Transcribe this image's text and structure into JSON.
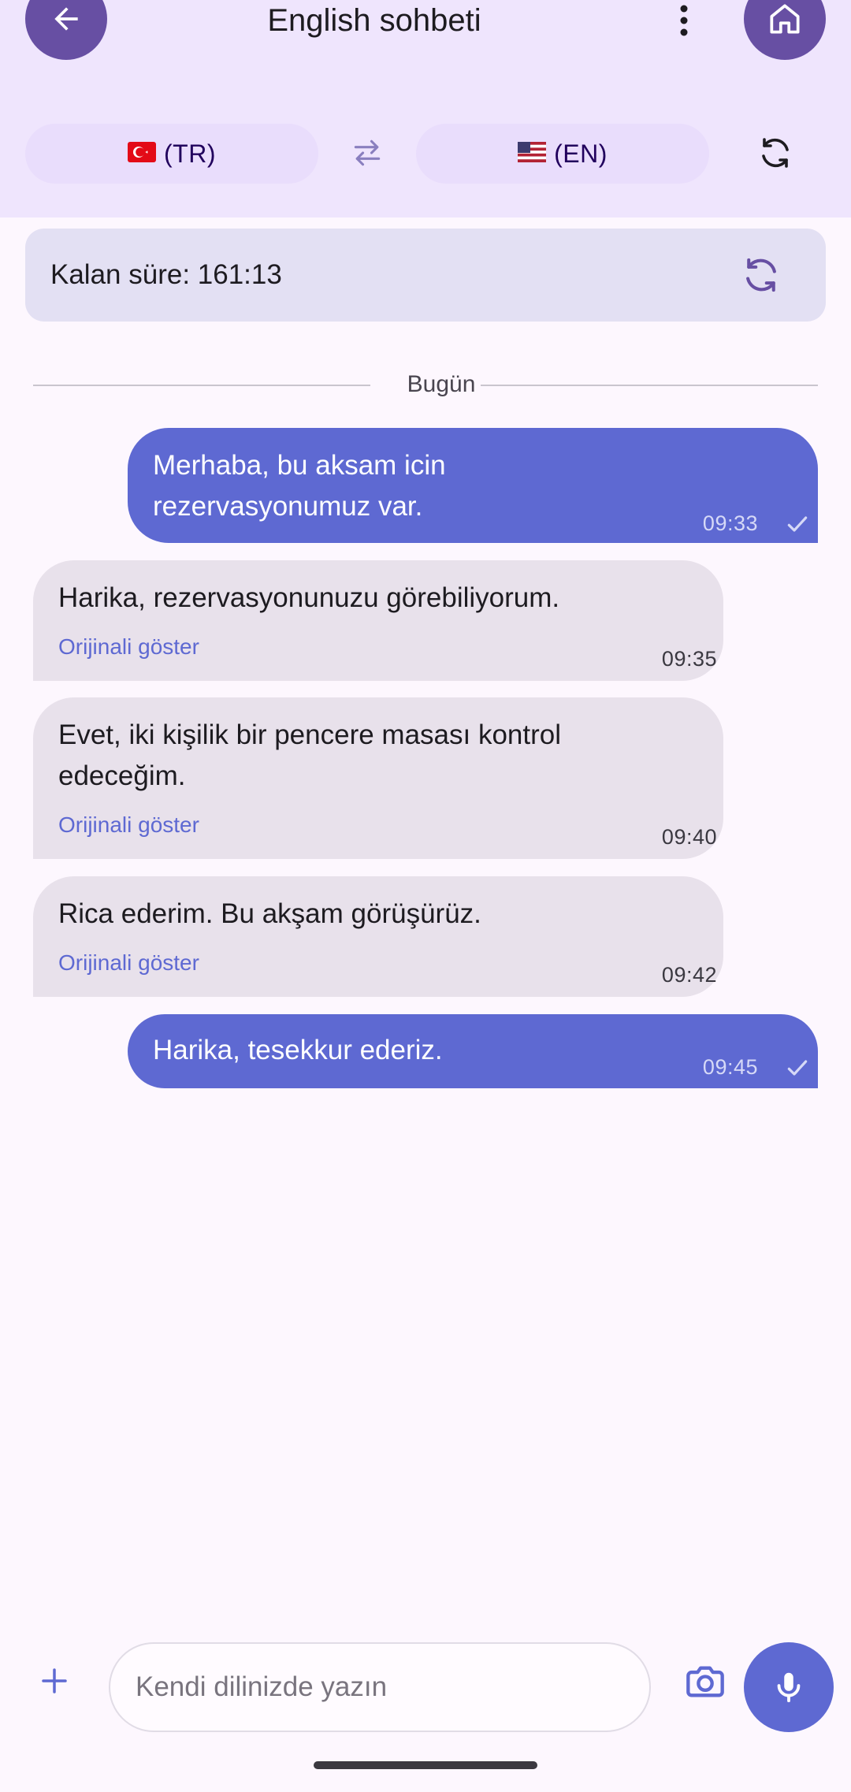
{
  "header": {
    "title": "English sohbeti",
    "back_icon": "arrow-left-icon",
    "home_icon": "home-icon",
    "more_icon": "more-vertical-icon"
  },
  "languages": {
    "source": {
      "flag": "flag-turkey-icon",
      "code": "(TR)"
    },
    "target": {
      "flag": "flag-usa-icon",
      "code": "(EN)"
    },
    "swap_icon": "swap-horizontal-icon",
    "refresh_icon": "refresh-icon"
  },
  "timer": {
    "text": "Kalan süre: 161:13",
    "refresh_icon": "refresh-icon"
  },
  "chat": {
    "date_divider": "Bugün",
    "messages": [
      {
        "direction": "outgoing",
        "text": "Merhaba, bu aksam icin rezervasyonumuz var.",
        "time": "09:33",
        "status_icon": "check-icon"
      },
      {
        "direction": "incoming",
        "text": "Harika, rezervasyonunuzu görebiliyorum.",
        "link": "Orijinali göster",
        "time": "09:35"
      },
      {
        "direction": "incoming",
        "text": "Evet, iki kişilik bir pencere masası kontrol edeceğim.",
        "link": "Orijinali göster",
        "time": "09:40"
      },
      {
        "direction": "incoming",
        "text": "Rica ederim. Bu akşam görüşürüz.",
        "link": "Orijinali göster",
        "time": "09:42"
      },
      {
        "direction": "outgoing",
        "text": "Harika, tesekkur ederiz.",
        "time": "09:45",
        "status_icon": "check-icon"
      }
    ]
  },
  "composer": {
    "placeholder": "Kendi dilinizde yazın",
    "value": "",
    "add_icon": "plus-icon",
    "camera_icon": "camera-icon",
    "mic_icon": "microphone-icon"
  },
  "colors": {
    "accent": "#5E69D2",
    "header_button": "#674FA3",
    "header_bg": "#EFE5FD",
    "incoming_bubble": "#E8E1EB",
    "background": "#FDF7FE"
  }
}
